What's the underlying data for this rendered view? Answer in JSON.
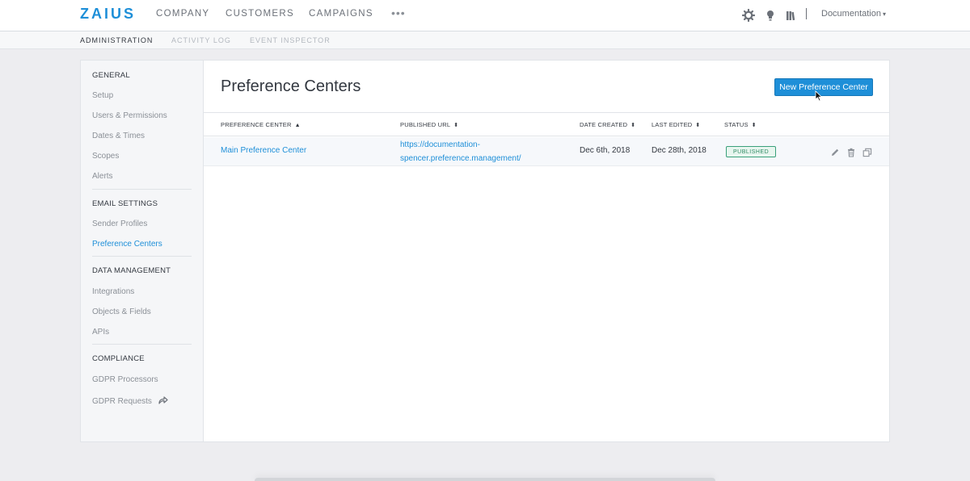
{
  "app": {
    "logo": "ZAIUS"
  },
  "topnav": {
    "items": [
      "COMPANY",
      "CUSTOMERS",
      "CAMPAIGNS"
    ],
    "more": "•••",
    "icons": [
      "gear-icon",
      "lightbulb-icon",
      "library-icon"
    ],
    "account_menu": "Documentation",
    "caret": "▾"
  },
  "subnav": {
    "tabs": [
      "ADMINISTRATION",
      "ACTIVITY LOG",
      "EVENT INSPECTOR"
    ],
    "active": "ADMINISTRATION"
  },
  "sidebar": {
    "sections": [
      {
        "title": "GENERAL",
        "items": [
          "Setup",
          "Users & Permissions",
          "Dates & Times",
          "Scopes",
          "Alerts"
        ]
      },
      {
        "title": "EMAIL SETTINGS",
        "items": [
          "Sender Profiles",
          "Preference Centers"
        ]
      },
      {
        "title": "DATA MANAGEMENT",
        "items": [
          "Integrations",
          "Objects & Fields",
          "APIs"
        ]
      },
      {
        "title": "COMPLIANCE",
        "items": [
          "GDPR Processors",
          "GDPR Requests"
        ]
      }
    ],
    "active_item": "Preference Centers",
    "external_icon": "share-arrow-icon"
  },
  "main": {
    "title": "Preference Centers",
    "new_button": "New Preference Center",
    "table": {
      "columns": [
        "PREFERENCE CENTER",
        "PUBLISHED URL",
        "DATE CREATED",
        "LAST EDITED",
        "STATUS"
      ],
      "sort_icons": [
        "▲",
        "⬍",
        "⬍",
        "⬍",
        "⬍"
      ],
      "rows": [
        {
          "name": "Main Preference Center",
          "url_line1": "https://documentation-",
          "url_line2": "spencer.preference.management/",
          "date_created": "Dec 6th, 2018",
          "last_edited": "Dec 28th, 2018",
          "status": "PUBLISHED",
          "actions": [
            "edit-pencil-icon",
            "trash-icon",
            "duplicate-icon"
          ]
        }
      ]
    }
  },
  "colors": {
    "accent": "#1e8fd8",
    "status_green": "#2e8a63",
    "page_bg": "#ededf0"
  }
}
